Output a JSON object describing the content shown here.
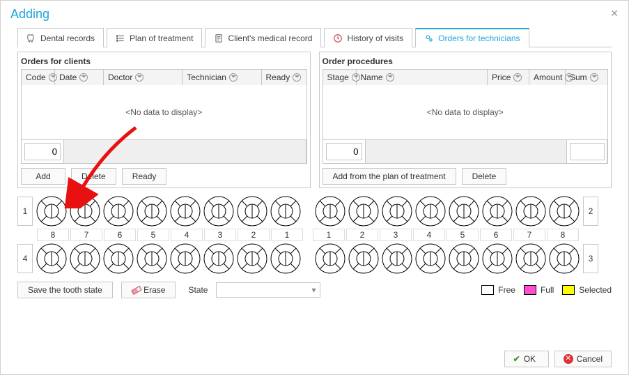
{
  "dialog": {
    "title": "Adding"
  },
  "tabs": [
    {
      "label": "Dental records"
    },
    {
      "label": "Plan of treatment"
    },
    {
      "label": "Client's medical record"
    },
    {
      "label": "History of visits"
    },
    {
      "label": "Orders for technicians"
    }
  ],
  "clients": {
    "title": "Orders for clients",
    "columns": [
      "Code",
      "Date",
      "Doctor",
      "Technician",
      "Ready"
    ],
    "empty": "<No data to display>",
    "footer_value": "0",
    "buttons": {
      "add": "Add",
      "delete": "Delete",
      "ready": "Ready"
    }
  },
  "procedures": {
    "title": "Order procedures",
    "columns": [
      "Stage",
      "Name",
      "Price",
      "Amount",
      "Sum"
    ],
    "empty": "<No data to display>",
    "footer_value": "0",
    "buttons": {
      "add_plan": "Add from the plan of treatment",
      "delete": "Delete"
    }
  },
  "teeth": {
    "upper_left_q": "1",
    "upper_right_q": "2",
    "lower_left_q": "4",
    "lower_right_q": "3",
    "numbers_left": [
      "8",
      "7",
      "6",
      "5",
      "4",
      "3",
      "2",
      "1"
    ],
    "numbers_right": [
      "1",
      "2",
      "3",
      "4",
      "5",
      "6",
      "7",
      "8"
    ]
  },
  "state": {
    "save_btn": "Save the tooth state",
    "erase_btn": "Erase",
    "label": "State",
    "legend": {
      "free": "Free",
      "full": "Full",
      "selected": "Selected"
    }
  },
  "footer": {
    "ok": "OK",
    "cancel": "Cancel"
  },
  "colors": {
    "full": "#ff4fd0",
    "selected": "#ffff00"
  }
}
